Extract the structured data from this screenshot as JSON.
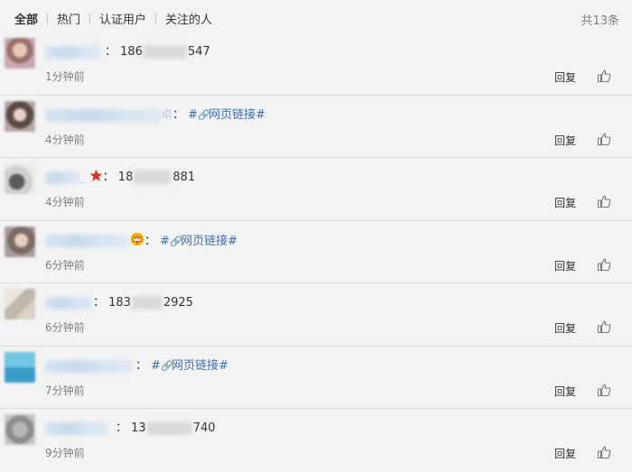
{
  "tabs": [
    "全部",
    "热门",
    "认证用户",
    "关注的人"
  ],
  "total": "共13条",
  "reply_label": "回复",
  "link_text": "网页链接",
  "link_color": "#3b6fb0",
  "comments": [
    {
      "pre": "186",
      "post": "547",
      "time": "1分钟前"
    },
    {
      "fragment": "卓",
      "time": "4分钟前"
    },
    {
      "fragment": "_",
      "pre": "18",
      "post": "881",
      "time": "4分钟前"
    },
    {
      "time": "6分钟前"
    },
    {
      "pre": "183",
      "post": "2925",
      "time": "6分钟前"
    },
    {
      "time": "7分钟前"
    },
    {
      "pre": "13",
      "post": "740",
      "time": "9分钟前"
    }
  ]
}
